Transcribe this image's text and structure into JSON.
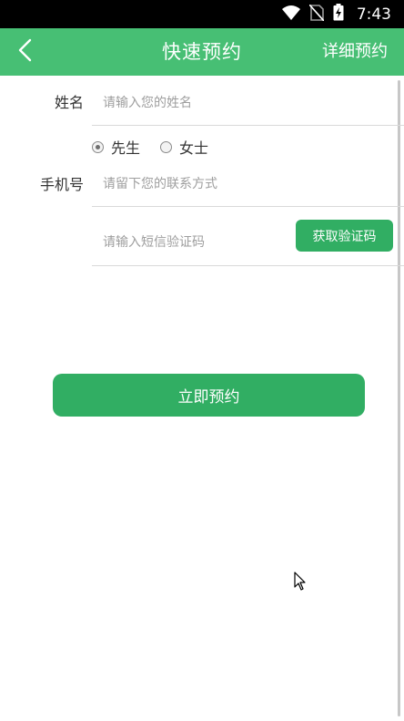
{
  "status_bar": {
    "time": "7:43"
  },
  "app_bar": {
    "title": "快速预约",
    "detail_link": "详细预约"
  },
  "form": {
    "name_label": "姓名",
    "name_placeholder": "请输入您的姓名",
    "gender": {
      "options": [
        "先生",
        "女士"
      ],
      "selected": "先生"
    },
    "phone_label": "手机号",
    "phone_placeholder": "请留下您的联系方式",
    "code_placeholder": "请输入短信验证码",
    "get_code_button": "获取验证码",
    "submit_button": "立即预约"
  },
  "colors": {
    "primary": "#47bf74",
    "button": "#31ae63"
  },
  "icons": [
    "wifi-icon",
    "no-sim-icon",
    "battery-charging-icon",
    "back-arrow-icon",
    "mouse-cursor-icon"
  ]
}
